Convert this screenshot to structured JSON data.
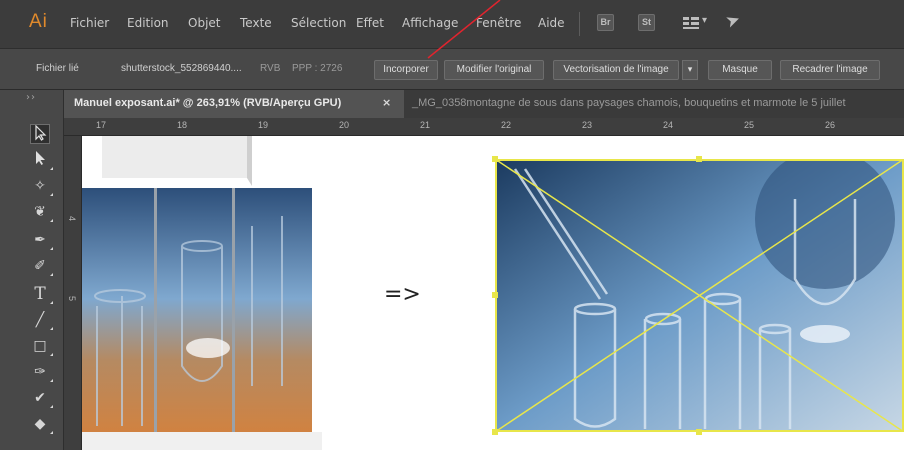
{
  "app": {
    "logo": "Ai"
  },
  "menu": {
    "items": [
      "Fichier",
      "Edition",
      "Objet",
      "Texte",
      "Sélection",
      "Effet",
      "Affichage",
      "Fenêtre",
      "Aide"
    ],
    "icons": [
      "bridge-icon",
      "stock-icon",
      "workspace-icon",
      "send-icon"
    ],
    "icon_labels": {
      "bridge": "Br",
      "stock": "St"
    }
  },
  "control_bar": {
    "linked_file_label": "Fichier lié",
    "file_name": "shutterstock_552869440....",
    "color_mode": "RVB",
    "ppi": "PPP : 2726",
    "buttons": {
      "embed": "Incorporer",
      "edit_original": "Modifier l'original",
      "image_trace": "Vectorisation de l'image",
      "mask": "Masque",
      "crop_image": "Recadrer l'image"
    }
  },
  "tabs": {
    "active_label": "Manuel exposant.ai* @ 263,91% (RVB/Aperçu GPU)",
    "close_symbol": "×",
    "inactive_label": "_MG_0358montagne de sous dans paysages chamois, bouquetins et marmote le 5 juillet"
  },
  "toolbar": {
    "grip": "››",
    "tools": [
      "selection-tool",
      "direct-selection-tool",
      "magic-wand-tool",
      "lasso-tool",
      "pen-tool",
      "curvature-tool",
      "type-tool",
      "line-tool",
      "rectangle-tool",
      "paintbrush-tool",
      "shaper-tool",
      "eraser-tool"
    ]
  },
  "ruler": {
    "numbers": [
      "17",
      "18",
      "19",
      "20",
      "21",
      "22",
      "23",
      "24",
      "25",
      "26"
    ],
    "vertical_numbers": [
      "4",
      "5"
    ]
  },
  "canvas": {
    "arrow_text": "=>"
  },
  "colors": {
    "selection_yellow": "#e8e64a",
    "annotation_red": "#e0242e",
    "logo_orange": "#e08a2c"
  }
}
